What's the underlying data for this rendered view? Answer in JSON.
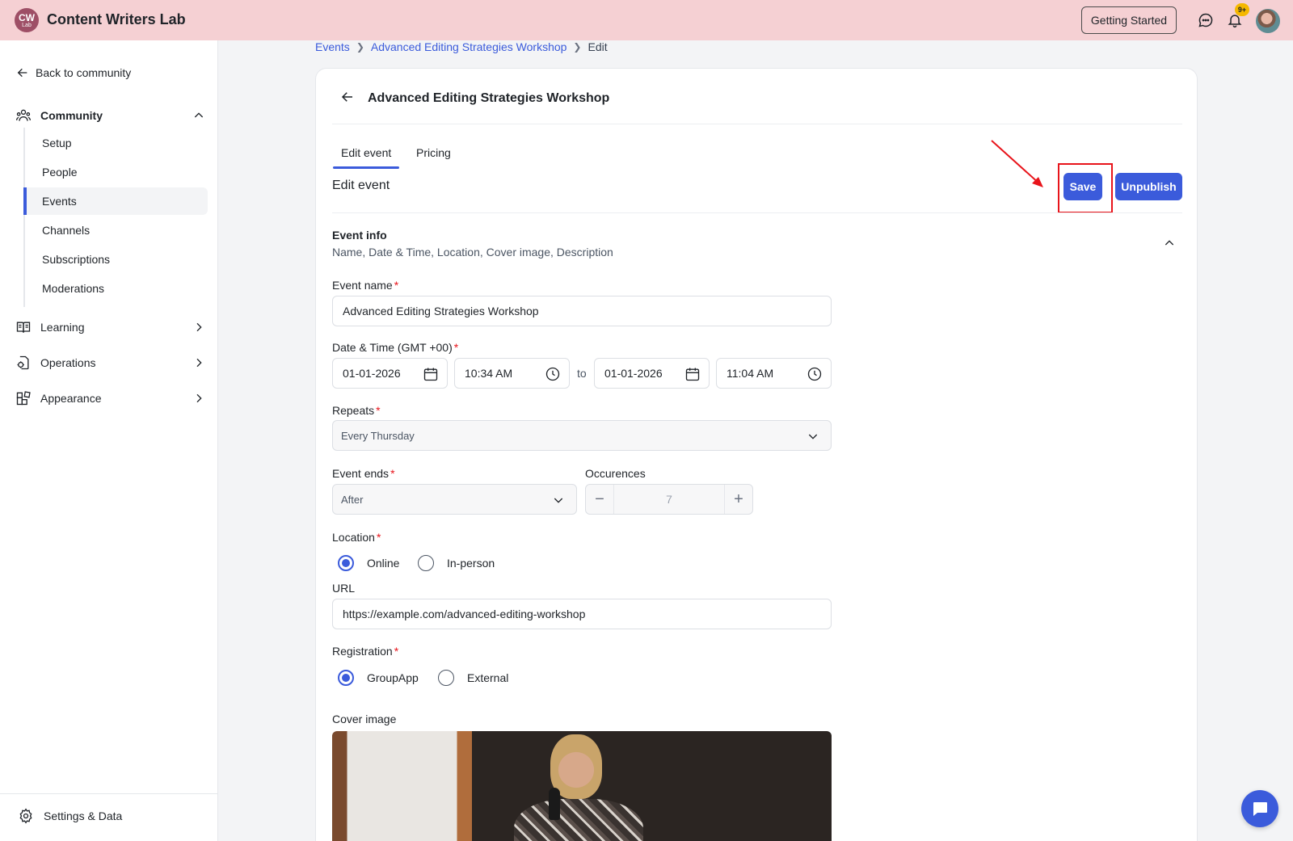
{
  "topbar": {
    "logo_line1": "CW",
    "logo_line2": "Lab",
    "brand": "Content Writers Lab",
    "getting_started": "Getting Started",
    "notifications_badge": "9+"
  },
  "sidebar": {
    "back_label": "Back to community",
    "community_label": "Community",
    "community_items": [
      "Setup",
      "People",
      "Events",
      "Channels",
      "Subscriptions",
      "Moderations"
    ],
    "active_item": "Events",
    "learning_label": "Learning",
    "operations_label": "Operations",
    "appearance_label": "Appearance",
    "settings_label": "Settings & Data"
  },
  "breadcrumb": {
    "events": "Events",
    "event": "Advanced Editing Strategies Workshop",
    "current": "Edit"
  },
  "card": {
    "title": "Advanced Editing Strategies Workshop",
    "tabs": [
      "Edit event",
      "Pricing"
    ],
    "active_tab": "Edit event",
    "section_title": "Edit event",
    "save_label": "Save",
    "unpublish_label": "Unpublish",
    "event_info_title": "Event info",
    "event_info_sub": "Name, Date & Time, Location, Cover image, Description"
  },
  "form": {
    "event_name_label": "Event name",
    "event_name_value": "Advanced Editing Strategies Workshop",
    "datetime_label": "Date & Time (GMT +00)",
    "start_date": "01-01-2026",
    "start_time": "10:34 AM",
    "to_label": "to",
    "end_date": "01-01-2026",
    "end_time": "11:04 AM",
    "repeats_label": "Repeats",
    "repeats_value": "Every Thursday",
    "event_ends_label": "Event ends",
    "event_ends_value": "After",
    "occurences_label": "Occurences",
    "occurences_value": "7",
    "location_label": "Location",
    "location_online": "Online",
    "location_inperson": "In-person",
    "location_selected": "Online",
    "url_label": "URL",
    "url_value": "https://example.com/advanced-editing-workshop",
    "registration_label": "Registration",
    "registration_groupapp": "GroupApp",
    "registration_external": "External",
    "registration_selected": "GroupApp",
    "cover_label": "Cover image",
    "required_mark": "*"
  },
  "colors": {
    "accent": "#3b5bdb",
    "topbar_bg": "#f5d0d3",
    "annotation_red": "#e8141b"
  }
}
